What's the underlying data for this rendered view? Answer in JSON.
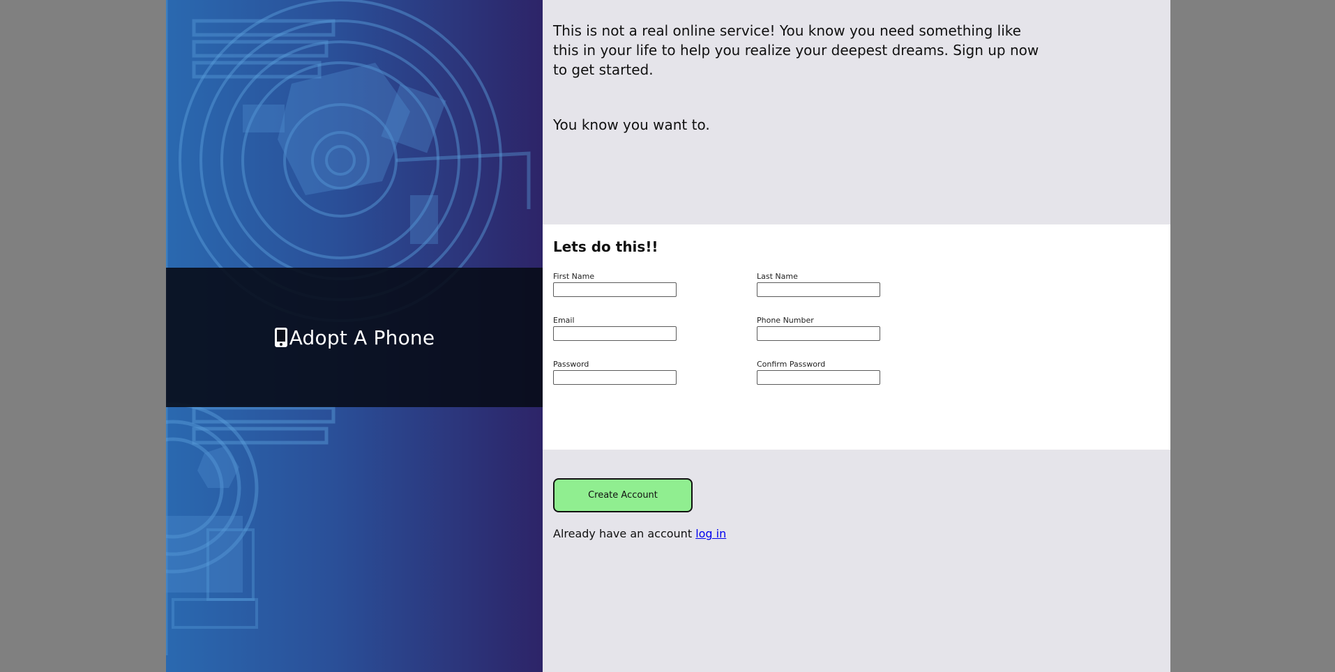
{
  "brand": {
    "name": "Adopt A Phone",
    "icon": "mobile-phone-icon"
  },
  "intro": {
    "paragraph": "This is not a real online service! You know you need something like this in your life to help you realize your deepest dreams. Sign up now to get started.",
    "tagline": "You know you want to."
  },
  "form": {
    "title": "Lets do this!!",
    "fields": {
      "first_name": {
        "label": "First Name",
        "value": ""
      },
      "last_name": {
        "label": "Last Name",
        "value": ""
      },
      "email": {
        "label": "Email",
        "value": ""
      },
      "phone": {
        "label": "Phone Number",
        "value": ""
      },
      "password": {
        "label": "Password",
        "value": ""
      },
      "confirm_password": {
        "label": "Confirm Password",
        "value": ""
      }
    }
  },
  "actions": {
    "create_account_label": "Create Account",
    "login_prompt": "Already have an account",
    "login_link": "log in"
  },
  "colors": {
    "page_background": "#e5e4ea",
    "outer_background": "#808080",
    "form_panel": "#ffffff",
    "button": "#90ee90",
    "link": "#0000ee",
    "hero_gradient_start": "#2a69b0",
    "hero_gradient_end": "#2d2468"
  }
}
